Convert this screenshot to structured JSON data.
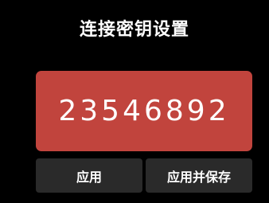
{
  "dialog": {
    "title": "连接密钥设置"
  },
  "key": {
    "value": "23546892"
  },
  "buttons": {
    "apply_label": "应用",
    "apply_save_label": "应用并保存"
  },
  "colors": {
    "background": "#000000",
    "key_panel": "#c1443d",
    "button": "#2a2a2a",
    "text": "#ffffff"
  }
}
